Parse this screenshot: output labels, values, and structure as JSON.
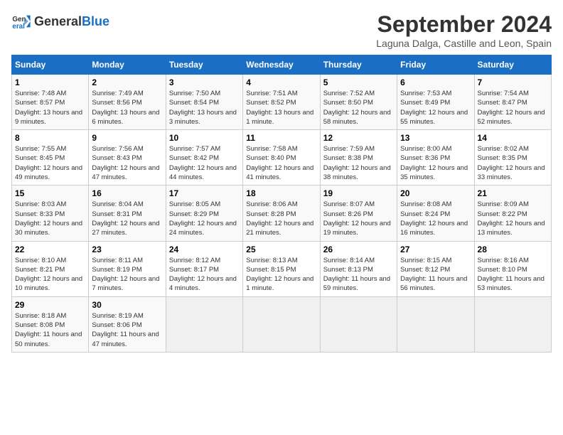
{
  "logo": {
    "general": "General",
    "blue": "Blue"
  },
  "title": "September 2024",
  "location": "Laguna Dalga, Castille and Leon, Spain",
  "days_header": [
    "Sunday",
    "Monday",
    "Tuesday",
    "Wednesday",
    "Thursday",
    "Friday",
    "Saturday"
  ],
  "weeks": [
    [
      {
        "day": "1",
        "sunrise": "7:48 AM",
        "sunset": "8:57 PM",
        "daylight": "13 hours and 9 minutes."
      },
      {
        "day": "2",
        "sunrise": "7:49 AM",
        "sunset": "8:56 PM",
        "daylight": "13 hours and 6 minutes."
      },
      {
        "day": "3",
        "sunrise": "7:50 AM",
        "sunset": "8:54 PM",
        "daylight": "13 hours and 3 minutes."
      },
      {
        "day": "4",
        "sunrise": "7:51 AM",
        "sunset": "8:52 PM",
        "daylight": "13 hours and 1 minute."
      },
      {
        "day": "5",
        "sunrise": "7:52 AM",
        "sunset": "8:50 PM",
        "daylight": "12 hours and 58 minutes."
      },
      {
        "day": "6",
        "sunrise": "7:53 AM",
        "sunset": "8:49 PM",
        "daylight": "12 hours and 55 minutes."
      },
      {
        "day": "7",
        "sunrise": "7:54 AM",
        "sunset": "8:47 PM",
        "daylight": "12 hours and 52 minutes."
      }
    ],
    [
      {
        "day": "8",
        "sunrise": "7:55 AM",
        "sunset": "8:45 PM",
        "daylight": "12 hours and 49 minutes."
      },
      {
        "day": "9",
        "sunrise": "7:56 AM",
        "sunset": "8:43 PM",
        "daylight": "12 hours and 47 minutes."
      },
      {
        "day": "10",
        "sunrise": "7:57 AM",
        "sunset": "8:42 PM",
        "daylight": "12 hours and 44 minutes."
      },
      {
        "day": "11",
        "sunrise": "7:58 AM",
        "sunset": "8:40 PM",
        "daylight": "12 hours and 41 minutes."
      },
      {
        "day": "12",
        "sunrise": "7:59 AM",
        "sunset": "8:38 PM",
        "daylight": "12 hours and 38 minutes."
      },
      {
        "day": "13",
        "sunrise": "8:00 AM",
        "sunset": "8:36 PM",
        "daylight": "12 hours and 35 minutes."
      },
      {
        "day": "14",
        "sunrise": "8:02 AM",
        "sunset": "8:35 PM",
        "daylight": "12 hours and 33 minutes."
      }
    ],
    [
      {
        "day": "15",
        "sunrise": "8:03 AM",
        "sunset": "8:33 PM",
        "daylight": "12 hours and 30 minutes."
      },
      {
        "day": "16",
        "sunrise": "8:04 AM",
        "sunset": "8:31 PM",
        "daylight": "12 hours and 27 minutes."
      },
      {
        "day": "17",
        "sunrise": "8:05 AM",
        "sunset": "8:29 PM",
        "daylight": "12 hours and 24 minutes."
      },
      {
        "day": "18",
        "sunrise": "8:06 AM",
        "sunset": "8:28 PM",
        "daylight": "12 hours and 21 minutes."
      },
      {
        "day": "19",
        "sunrise": "8:07 AM",
        "sunset": "8:26 PM",
        "daylight": "12 hours and 19 minutes."
      },
      {
        "day": "20",
        "sunrise": "8:08 AM",
        "sunset": "8:24 PM",
        "daylight": "12 hours and 16 minutes."
      },
      {
        "day": "21",
        "sunrise": "8:09 AM",
        "sunset": "8:22 PM",
        "daylight": "12 hours and 13 minutes."
      }
    ],
    [
      {
        "day": "22",
        "sunrise": "8:10 AM",
        "sunset": "8:21 PM",
        "daylight": "12 hours and 10 minutes."
      },
      {
        "day": "23",
        "sunrise": "8:11 AM",
        "sunset": "8:19 PM",
        "daylight": "12 hours and 7 minutes."
      },
      {
        "day": "24",
        "sunrise": "8:12 AM",
        "sunset": "8:17 PM",
        "daylight": "12 hours and 4 minutes."
      },
      {
        "day": "25",
        "sunrise": "8:13 AM",
        "sunset": "8:15 PM",
        "daylight": "12 hours and 1 minute."
      },
      {
        "day": "26",
        "sunrise": "8:14 AM",
        "sunset": "8:13 PM",
        "daylight": "11 hours and 59 minutes."
      },
      {
        "day": "27",
        "sunrise": "8:15 AM",
        "sunset": "8:12 PM",
        "daylight": "11 hours and 56 minutes."
      },
      {
        "day": "28",
        "sunrise": "8:16 AM",
        "sunset": "8:10 PM",
        "daylight": "11 hours and 53 minutes."
      }
    ],
    [
      {
        "day": "29",
        "sunrise": "8:18 AM",
        "sunset": "8:08 PM",
        "daylight": "11 hours and 50 minutes."
      },
      {
        "day": "30",
        "sunrise": "8:19 AM",
        "sunset": "8:06 PM",
        "daylight": "11 hours and 47 minutes."
      },
      null,
      null,
      null,
      null,
      null
    ]
  ]
}
